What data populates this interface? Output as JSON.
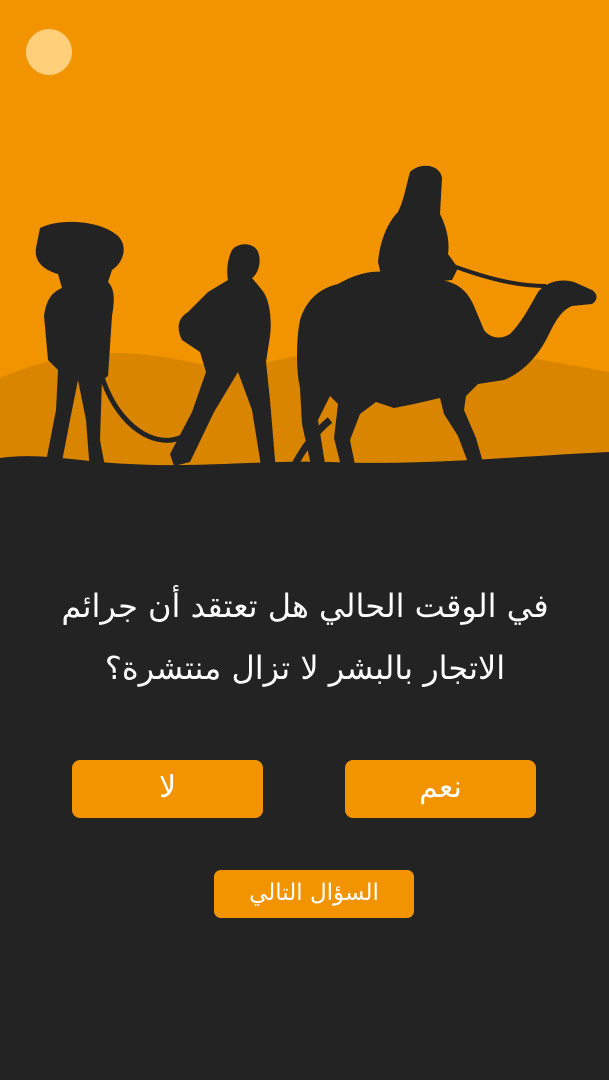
{
  "question": {
    "text": "في الوقت الحالي هل تعتقد أن جرائم الاتجار بالبشر لا تزال منتشرة؟"
  },
  "answers": {
    "yes_label": "نعم",
    "no_label": "لا"
  },
  "navigation": {
    "next_label": "السؤال التالي"
  },
  "colors": {
    "accent": "#f29400",
    "background": "#232323",
    "dune": "#d98500",
    "silhouette": "#232323",
    "sun": "#ffcf7a"
  }
}
